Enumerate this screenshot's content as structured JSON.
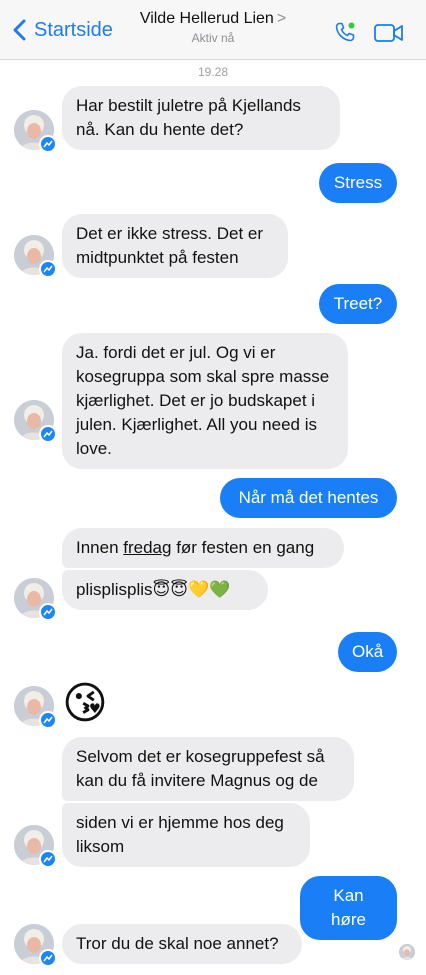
{
  "header": {
    "back_label": "Startside",
    "contact_name": "Vilde Hellerud Lien",
    "contact_caret": ">",
    "status": "Aktiv nå",
    "accent_color": "#1a7ff6"
  },
  "timestamp": "19.28",
  "messages": {
    "m1": "Har bestilt juletre på Kjellands nå. Kan du hente det?",
    "m2": "Stress",
    "m3": "Det er ikke stress. Det er midtpunktet på festen",
    "m4": "Treet?",
    "m5": "Ja. fordi det er jul. Og vi er kosegruppa som skal spre masse kjærlighet. Det er jo budskapet i julen. Kjærlighet. All you need is love.",
    "m6": "Når må det hentes",
    "m7_before": "Innen ",
    "m7_link": "fredag",
    "m7_after": " før festen en gang",
    "m8": "plisplisplis😇😇💛💚",
    "m9": "Okå",
    "m10": "😘",
    "m11": "Selvom det er kosegruppefest så kan du få invitere Magnus og de",
    "m12": "siden vi er hjemme hos deg liksom",
    "m13": "Kan høre",
    "m14": "Tror du de skal noe annet?"
  },
  "icons": {
    "back": "chevron-left-icon",
    "call": "phone-icon",
    "video": "video-camera-icon",
    "badge": "messenger-bolt-icon"
  }
}
